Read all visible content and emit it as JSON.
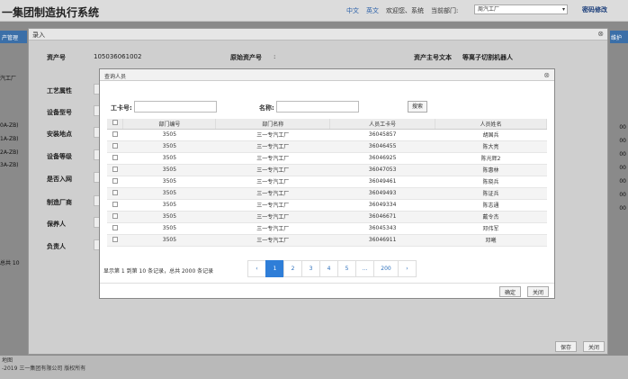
{
  "app": {
    "title": "一集团制造执行系统",
    "links": [
      "中文",
      "英文"
    ],
    "welcome": "欢迎您、系统",
    "dept_label": "当前部门:",
    "dept_value": "周汽工厂",
    "change_pwd": "密码修改",
    "tab": "产管理",
    "tab_right": "维护",
    "side_texts": [
      "汽工厂",
      "0A-ZB)",
      "1A-ZB)",
      "2A-ZB)",
      "3A-ZB)",
      "总共 10"
    ],
    "right_texts": [
      "00",
      "00",
      "00",
      "00",
      "00",
      "00",
      "00"
    ],
    "footer_line1": "地图",
    "footer_line2": "-2019 三一集团有限公司 版权所有"
  },
  "dialog": {
    "title": "录入",
    "asset_no_label": "资产号",
    "asset_no_value": "105036061002",
    "orig_asset_label": "原始资产号",
    "orig_asset_value": ":",
    "asset_text_label": "资产主号文本",
    "asset_text_value": "等离子切割机器人",
    "fields": [
      "工艺属性",
      "设备型号",
      "安装地点",
      "设备等级",
      "是否入网",
      "制造厂商",
      "保养人",
      "负责人"
    ],
    "save_label": "保存",
    "close_label": "关闭"
  },
  "search_dialog": {
    "title": "查询人员",
    "card_label": "工卡号:",
    "name_label": "名称:",
    "search_label": "搜索",
    "columns": [
      "部门编号",
      "部门名称",
      "人员工卡号",
      "人员姓名"
    ],
    "rows": [
      [
        "3505",
        "三一专汽工厂",
        "36045857",
        "胡国兵"
      ],
      [
        "3505",
        "三一专汽工厂",
        "36046455",
        "陈大亮"
      ],
      [
        "3505",
        "三一专汽工厂",
        "36046925",
        "陈光辉2"
      ],
      [
        "3505",
        "三一专汽工厂",
        "36047053",
        "陈惠林"
      ],
      [
        "3505",
        "三一专汽工厂",
        "36049461",
        "陈晓兵"
      ],
      [
        "3505",
        "三一专汽工厂",
        "36049493",
        "陈证兵"
      ],
      [
        "3505",
        "三一专汽工厂",
        "36049334",
        "陈志通"
      ],
      [
        "3505",
        "三一专汽工厂",
        "36046671",
        "戴令杰"
      ],
      [
        "3505",
        "三一专汽工厂",
        "36045343",
        "邓伟军"
      ],
      [
        "3505",
        "三一专汽工厂",
        "36046911",
        "邓曦"
      ]
    ],
    "pagination_info": "显示第 1 到第 10 条记录，总共 2000 条记录",
    "pages": [
      "‹",
      "1",
      "2",
      "3",
      "4",
      "5",
      "...",
      "200",
      "›"
    ],
    "active_page": "1",
    "confirm_label": "确定",
    "close_label": "关闭"
  }
}
